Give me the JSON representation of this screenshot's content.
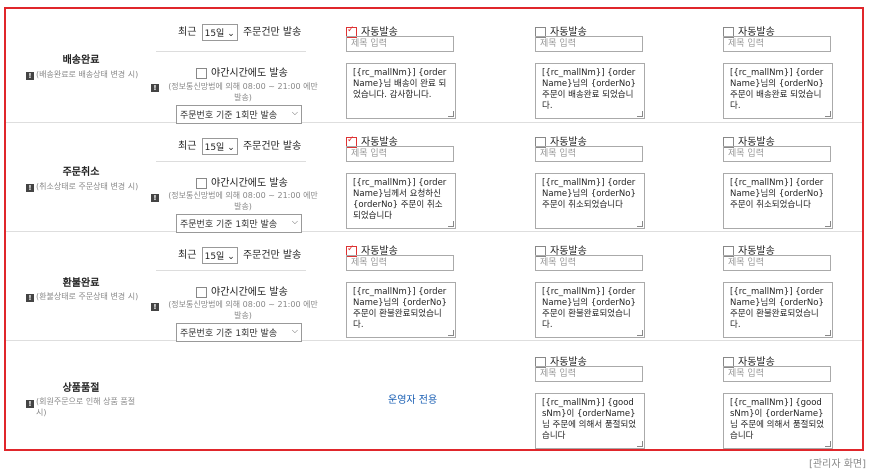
{
  "caption": "[관리자 화면]",
  "common": {
    "send_prefix": "최근",
    "period": "15일",
    "send_suffix": "주문건만 발송",
    "night_label": "야간시간에도 발송",
    "night_note": "(정보통신망법에 의해 08:00 ~ 21:00 에만 발송)",
    "once_option": "주문번호 기준 1회만 발송",
    "auto_label": "자동발송",
    "subject_placeholder": "제목 입력",
    "admin_only": "운영자 전용"
  },
  "rows": [
    {
      "title": "배송완료",
      "note": "(배송완료로 배송상태 변경 시)",
      "columns": [
        {
          "checked": true,
          "body": "[{rc_mallNm}] {orderName}님 배송이 완료 되었습니다. 감사합니다."
        },
        {
          "checked": false,
          "body": "[{rc_mallNm}] {orderName}님의 {orderNo} 주문이 배송완료 되었습니다."
        },
        {
          "checked": false,
          "body": "[{rc_mallNm}] {orderName}님의 {orderNo} 주문이 배송완료 되었습니다."
        }
      ]
    },
    {
      "title": "주문취소",
      "note": "(취소상태로 주문상태 변경 시)",
      "columns": [
        {
          "checked": true,
          "body": "[{rc_mallNm}] {orderName}님께서 요청하신 {orderNo} 주문이 취소되었습니다"
        },
        {
          "checked": false,
          "body": "[{rc_mallNm}] {orderName}님의 {orderNo} 주문이 취소되었습니다"
        },
        {
          "checked": false,
          "body": "[{rc_mallNm}] {orderName}님의 {orderNo} 주문이 취소되었습니다"
        }
      ]
    },
    {
      "title": "환불완료",
      "note": "(환불상태로 주문상태 변경 시)",
      "columns": [
        {
          "checked": true,
          "body": "[{rc_mallNm}] {orderName}님의 {orderNo} 주문이 환불완료되었습니다."
        },
        {
          "checked": false,
          "body": "[{rc_mallNm}] {orderName}님의 {orderNo} 주문이 환불완료되었습니다."
        },
        {
          "checked": false,
          "body": "[{rc_mallNm}] {orderName}님의 {orderNo} 주문이 환불완료되었습니다."
        }
      ]
    },
    {
      "title": "상품품절",
      "note": "(회원주문으로 인해 상품 품절 시)",
      "columns": [
        {
          "checked": false,
          "body": "[{rc_mallNm}] {goodsNm}이 {orderName}님 주문에 의해서 품절되었습니다"
        },
        {
          "checked": false,
          "body": "[{rc_mallNm}] {goodsNm}이 {orderName}님 주문에 의해서 품절되었습니다"
        }
      ]
    }
  ]
}
